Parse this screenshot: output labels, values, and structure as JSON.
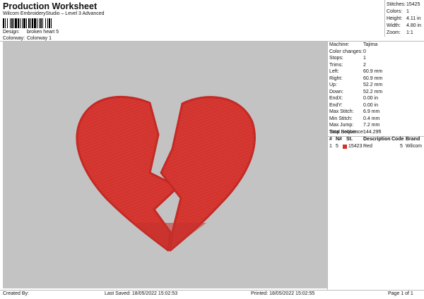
{
  "header": {
    "title": "Production Worksheet",
    "subtitle": "Wilcom EmbroideryStudio – Level 3 Advanced"
  },
  "design_info": {
    "design_label": "Design:",
    "design_value": "broken heart 5",
    "colorway_label": "Colorway:",
    "colorway_value": "Colorway 1"
  },
  "summary": [
    {
      "label": "Stitches:",
      "value": "15425"
    },
    {
      "label": "Colors:",
      "value": "1"
    },
    {
      "label": "Height:",
      "value": "4.11 in"
    },
    {
      "label": "Width:",
      "value": "4.80 in"
    },
    {
      "label": "Zoom:",
      "value": "1:1"
    }
  ],
  "details": [
    {
      "label": "Machine:",
      "value": "Tajima"
    },
    {
      "label": "Color changes:",
      "value": "0"
    },
    {
      "label": "Stops:",
      "value": "1"
    },
    {
      "label": "Trims:",
      "value": "2"
    },
    {
      "label": "Left:",
      "value": "60.9 mm"
    },
    {
      "label": "Right:",
      "value": "60.9 mm"
    },
    {
      "label": "Up:",
      "value": "52.2 mm"
    },
    {
      "label": "Down:",
      "value": "52.2 mm"
    },
    {
      "label": "EndX:",
      "value": "0.00 in"
    },
    {
      "label": "EndY:",
      "value": "0.00 in"
    },
    {
      "label": "Max Stitch:",
      "value": "6.9 mm"
    },
    {
      "label": "Min Stitch:",
      "value": "0.4 mm"
    },
    {
      "label": "Max Jump:",
      "value": "7.2 mm"
    },
    {
      "label": "Total Bobbin:",
      "value": "144.29ft"
    }
  ],
  "stop_sequence": {
    "title": "Stop Sequence:",
    "headers": [
      "#",
      "N#",
      "St.",
      "Description",
      "Code",
      "Brand"
    ],
    "rows": [
      {
        "index": "1",
        "needle": "5",
        "color": "#d2302a",
        "stitches": "15423",
        "description": "Red",
        "code": "5",
        "brand": "Wilcom"
      }
    ]
  },
  "design_colors": {
    "canvas_bg": "#c3c3c3",
    "thread": "#d2302a"
  },
  "footer": {
    "created_by": "Created By:",
    "last_saved": "Last Saved: 18/05/2022 15:02:53",
    "printed": "Printed: 18/05/2022 15:02:55",
    "page": "Page 1 of 1"
  }
}
